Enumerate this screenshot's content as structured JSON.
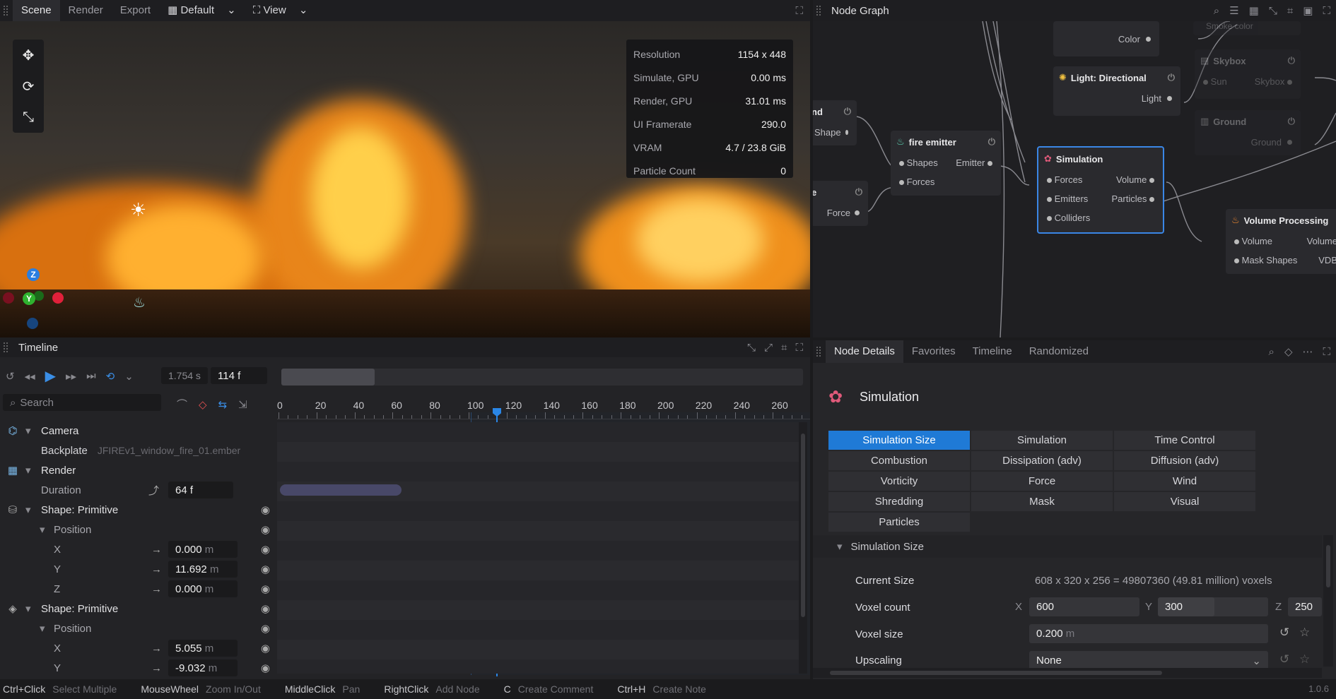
{
  "top_tabs": {
    "scene": "Scene",
    "render": "Render",
    "export": "Export",
    "layout": "Default",
    "view": "View"
  },
  "node_graph_title": "Node Graph",
  "stats": [
    {
      "label": "Resolution",
      "value": "1154 x 448"
    },
    {
      "label": "Simulate, GPU",
      "value": "0.00 ms"
    },
    {
      "label": "Render, GPU",
      "value": "31.01 ms"
    },
    {
      "label": "UI Framerate",
      "value": "290.0"
    },
    {
      "label": "VRAM",
      "value": "4.7 / 23.8 GiB"
    },
    {
      "label": "Particle Count",
      "value": "0"
    }
  ],
  "gizmo": {
    "z": "Z",
    "y": "Y"
  },
  "nodes": {
    "color": {
      "out": "Color"
    },
    "smoke_color": {
      "label": "Smoke color"
    },
    "light": {
      "title": "Light: Directional",
      "out": "Light"
    },
    "skybox": {
      "title": "Skybox",
      "in": "Sun",
      "out": "Skybox"
    },
    "ground": {
      "title": "Ground",
      "out": "Ground"
    },
    "shape_partial": {
      "title": "nd",
      "out": "Shape"
    },
    "force_partial": {
      "title": "e",
      "out": "Force"
    },
    "fire_emitter": {
      "title": "fire emitter",
      "in1": "Shapes",
      "in2": "Forces",
      "out": "Emitter"
    },
    "simulation": {
      "title": "Simulation",
      "in1": "Forces",
      "in2": "Emitters",
      "in3": "Colliders",
      "out1": "Volume",
      "out2": "Particles"
    },
    "volume_processing": {
      "title": "Volume Processing",
      "in1": "Volume",
      "in2": "Mask Shapes",
      "out1": "Volume",
      "out2": "VDB"
    }
  },
  "timeline": {
    "title": "Timeline",
    "time": "1.754 s",
    "frame": "114 f",
    "search_placeholder": "Search",
    "ruler": [
      "0",
      "20",
      "40",
      "60",
      "80",
      "100",
      "120",
      "140",
      "160",
      "180",
      "200",
      "220",
      "240",
      "260"
    ],
    "rows": {
      "camera": "Camera",
      "backplate_label": "Backplate",
      "backplate_value": "JFIREv1_window_fire_01.ember",
      "render": "Render",
      "duration_label": "Duration",
      "duration_value": "64 f",
      "shape1": "Shape: Primitive",
      "position1": "Position",
      "x1_label": "X",
      "x1_value": "0.000",
      "x1_unit": "m",
      "y1_label": "Y",
      "y1_value": "11.692",
      "y1_unit": "m",
      "z1_label": "Z",
      "z1_value": "0.000",
      "z1_unit": "m",
      "shape2": "Shape: Primitive",
      "position2": "Position",
      "x2_label": "X",
      "x2_value": "5.055",
      "x2_unit": "m",
      "y2_label": "Y",
      "y2_value": "-9.032",
      "y2_unit": "m"
    }
  },
  "details": {
    "tabs": {
      "node_details": "Node Details",
      "favorites": "Favorites",
      "timeline": "Timeline",
      "randomized": "Randomized"
    },
    "title": "Simulation",
    "grid": [
      "Simulation Size",
      "Simulation",
      "Time Control",
      "Combustion",
      "Dissipation (adv)",
      "Diffusion (adv)",
      "Vorticity",
      "Force",
      "Wind",
      "Shredding",
      "Mask",
      "Visual",
      "Particles"
    ],
    "section": "Simulation Size",
    "current_size_label": "Current Size",
    "current_size_value": "608 x 320 x 256 = 49807360 (49.81 million) voxels",
    "voxel_count_label": "Voxel count",
    "vx_label": "X",
    "vx": "600",
    "vy_label": "Y",
    "vy": "300",
    "vz_label": "Z",
    "vz": "250",
    "voxel_size_label": "Voxel size",
    "voxel_size_value": "0.200",
    "voxel_size_unit": "m",
    "upscaling_label": "Upscaling",
    "upscaling_value": "None"
  },
  "status": [
    {
      "key": "Ctrl+Click",
      "desc": "Select Multiple"
    },
    {
      "key": "MouseWheel",
      "desc": "Zoom In/Out"
    },
    {
      "key": "MiddleClick",
      "desc": "Pan"
    },
    {
      "key": "RightClick",
      "desc": "Add Node"
    },
    {
      "key": "C",
      "desc": "Create Comment"
    },
    {
      "key": "Ctrl+H",
      "desc": "Create Note"
    }
  ],
  "version": "1.0.6"
}
